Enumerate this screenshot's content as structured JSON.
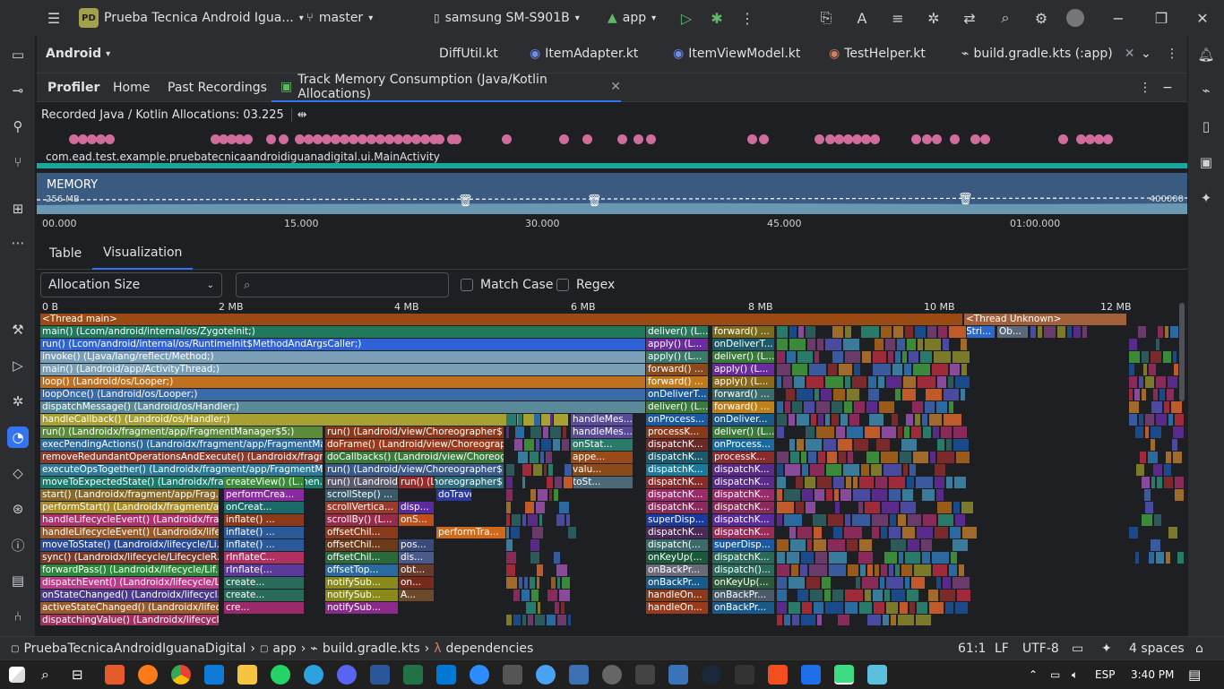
{
  "titlebar": {
    "project_badge": "PD",
    "project_name": "Prueba Tecnica Android Igua...",
    "branch": "master",
    "device": "samsung SM-S901B",
    "run_config": "app"
  },
  "sidebar_left": {
    "project_view": "Android"
  },
  "editor_tabs": [
    "DiffUtil.kt",
    "ItemAdapter.kt",
    "ItemViewModel.kt",
    "TestHelper.kt",
    "build.gradle.kts (:app)"
  ],
  "profiler": {
    "title": "Profiler",
    "tabs": [
      "Home",
      "Past Recordings",
      "Track Memory Consumption (Java/Kotlin Allocations)"
    ],
    "recorded_label": "Recorded Java / Kotlin Allocations: 03.225",
    "activity_label": "com.ead.test.example.pruebatecnicaandroidiguanadigital.ui.MainActivity",
    "memory_label": "MEMORY",
    "memory_scale_left": "256 MB",
    "memory_scale_right": "400000",
    "time_ticks": [
      "00.000",
      "15.000",
      "30.000",
      "45.000",
      "01:00.000"
    ],
    "view_tabs": [
      "Table",
      "Visualization"
    ],
    "selected_view_tab": "Visualization",
    "dropdown_value": "Allocation Size",
    "search_placeholder": "",
    "match_case_label": "Match Case",
    "regex_label": "Regex",
    "size_ticks": [
      "0 B",
      "2 MB",
      "4 MB",
      "6 MB",
      "8 MB",
      "10 MB",
      "12 MB"
    ]
  },
  "flame": {
    "main_rows": [
      "<Thread main>",
      "main() (Lcom/android/internal/os/ZygoteInit;)",
      "run() (Lcom/android/internal/os/RuntimeInit$MethodAndArgsCaller;)",
      "invoke() (Ljava/lang/reflect/Method;)",
      "main() (Landroid/app/ActivityThread;)",
      "loop() (Landroid/os/Looper;)",
      "loopOnce() (Landroid/os/Looper;)",
      "dispatchMessage() (Landroid/os/Handler;)",
      "handleCallback() (Landroid/os/Handler;)",
      "run() (Landroidx/fragment/app/FragmentManager$5;)",
      "execPendingActions() (Landroidx/fragment/app/FragmentMa...",
      "removeRedundantOperationsAndExecute() (Landroidx/fragm...",
      "executeOpsTogether() (Landroidx/fragment/app/FragmentM...",
      "moveToExpectedState() (Landroidx/fragment/app/Fragmen...",
      "start() (Landroidx/fragment/app/Frag...",
      "performStart() (Landroidx/fragment/a...",
      "handleLifecycleEvent() (Landroidx/fra...",
      "handleLifecycleEvent() (Landroidx/life...",
      "moveToState() (Landroidx/lifecycle/Li...",
      "sync() (Landroidx/lifecycle/LifecycleR...",
      "forwardPass() (Landroidx/lifecycle/Lif...",
      "dispatchEvent() (Landroidx/lifecycle/L...",
      "onStateChanged() (Landroidx/lifecycl...",
      "activeStateChanged() (Landroidx/lifec...",
      "dispatchingValue() (Landroidx/lifecycl..."
    ],
    "mid_col1": [
      "run() (Landroid/view/Choreographer$...",
      "doFrame() (Landroid/view/Choreograp...",
      "doCallbacks() (Landroid/view/Choreog...",
      "run() (Landroid/view/Choreographer$...",
      "run() (Landroid/view/Choreographer$..."
    ],
    "col_a": [
      "createView() (L...",
      "performCrea...",
      "onCreat...",
      "inflate() ...",
      "inflate() ...",
      "inflate() ...",
      "rInflateC...",
      "rInflate(...",
      "create...",
      "create...",
      "cre..."
    ],
    "col_b": [
      "run() (Landroidx/recy...",
      "scrollStep() ...",
      "scrollVertica...",
      "scrollBy() (L...",
      "offsetChil...",
      "offsetChil...",
      "offsetChil...",
      "offsetTop...",
      "notifySub...",
      "notifySub...",
      "notifySub..."
    ],
    "col_c": [
      "run() (Land...",
      "doTraversa...",
      "disp...",
      "onS...",
      "performTra...",
      "pos...",
      "dis...",
      "obt...",
      "on...",
      "A..."
    ],
    "col_d": [
      "handleMes...",
      "handleMes...",
      "onStat...",
      "appe...",
      "valu...",
      "toSt..."
    ],
    "col_e": [
      "deliver() (L...",
      "apply() (L...",
      "apply() (L...",
      "forward() ...",
      "forward() ...",
      "onDeliverT...",
      "deliver() (L...",
      "onProcess...",
      "processK...",
      "dispatchK...",
      "dispatchK...",
      "dispatchK...",
      "dispatchK...",
      "dispatchK...",
      "dispatchK...",
      "superDisp...",
      "dispatchK...",
      "dispatch(...",
      "onKeyUp(...",
      "onBackPr...",
      "onBackPr...",
      "handleOn...",
      "handleOn..."
    ],
    "col_f": [
      "forward() ...",
      "onDeliverT...",
      "deliver() (L...",
      "apply() (L...",
      "apply() (L...",
      "forward() ...",
      "forward() ...",
      "onDeliver...",
      "deliver() (L...",
      "onProcess...",
      "processK...",
      "dispatchK...",
      "dispatchK...",
      "dispatchK...",
      "dispatchK...",
      "dispatchK...",
      "dispatchK...",
      "superDisp...",
      "dispatchK...",
      "dispatch()...",
      "onKeyUp(...",
      "onBackPr...",
      "onBackPr..."
    ],
    "thread_unknown": "<Thread Unknown>",
    "unknown_children": [
      "Stri...",
      "Ob..."
    ]
  },
  "statusbar": {
    "breadcrumbs": [
      "PruebaTecnicaAndroidIguanaDigital",
      "app",
      "build.gradle.kts",
      "dependencies"
    ],
    "position": "61:1",
    "line_ending": "LF",
    "encoding": "UTF-8",
    "indent": "4 spaces"
  },
  "taskbar": {
    "language": "ESP",
    "time": "3:40 PM"
  }
}
